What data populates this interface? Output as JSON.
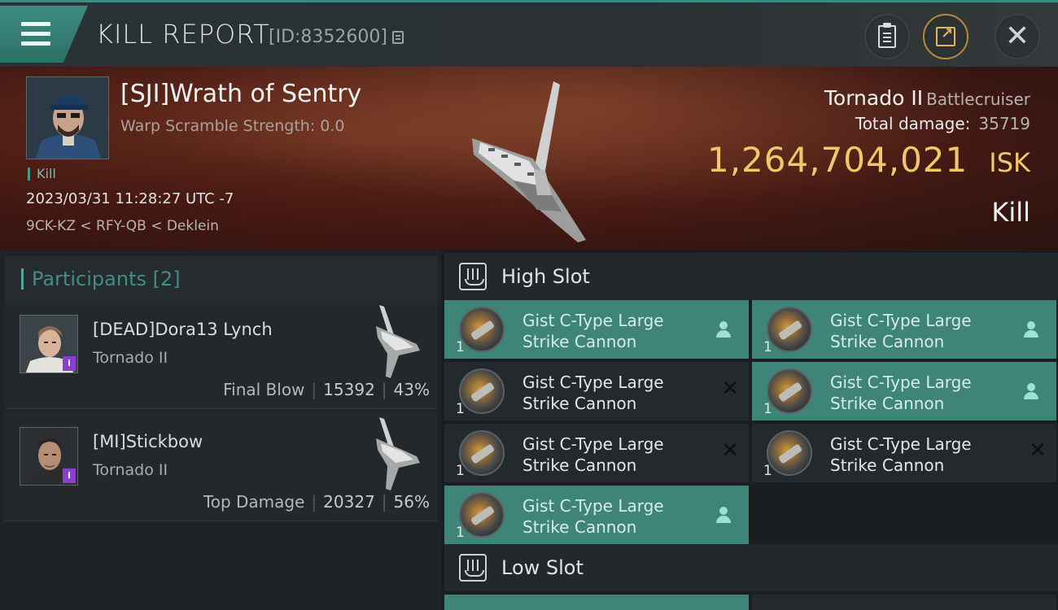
{
  "header": {
    "title": "KILL REPORT",
    "report_id": "[ID:8352600]"
  },
  "victim": {
    "name": "[SJI]Wrath of Sentry",
    "warp_scramble": "Warp Scramble Strength: 0.0",
    "kill_tag": "Kill",
    "timestamp": "2023/03/31 11:28:27 UTC -7",
    "location": "9CK-KZ < RFY-QB < Deklein",
    "ship_name": "Tornado II",
    "ship_class": "Battlecruiser",
    "total_damage_label": "Total damage:",
    "total_damage_value": "35719",
    "isk_value": "1,264,704,021",
    "isk_unit": "ISK",
    "result": "Kill"
  },
  "participants": {
    "label": "Participants",
    "count": "[2]",
    "items": [
      {
        "name": "[DEAD]Dora13 Lynch",
        "ship": "Tornado II",
        "role": "Final Blow",
        "damage": "15392",
        "percent": "43%"
      },
      {
        "name": "[MI]Stickbow",
        "ship": "Tornado II",
        "role": "Top Damage",
        "damage": "20327",
        "percent": "56%"
      }
    ]
  },
  "slots": {
    "high_label": "High Slot",
    "low_label": "Low Slot",
    "module_line1": "Gist C-Type Large",
    "module_line2": "Strike Cannon",
    "qty": "1",
    "high_modules": [
      {
        "status": "dropped"
      },
      {
        "status": "dropped"
      },
      {
        "status": "destroyed"
      },
      {
        "status": "dropped"
      },
      {
        "status": "destroyed"
      },
      {
        "status": "destroyed"
      },
      {
        "status": "dropped"
      }
    ]
  },
  "colors": {
    "accent": "#3e8478",
    "isk": "#f0c869",
    "hero_bg": "#5a2418"
  }
}
